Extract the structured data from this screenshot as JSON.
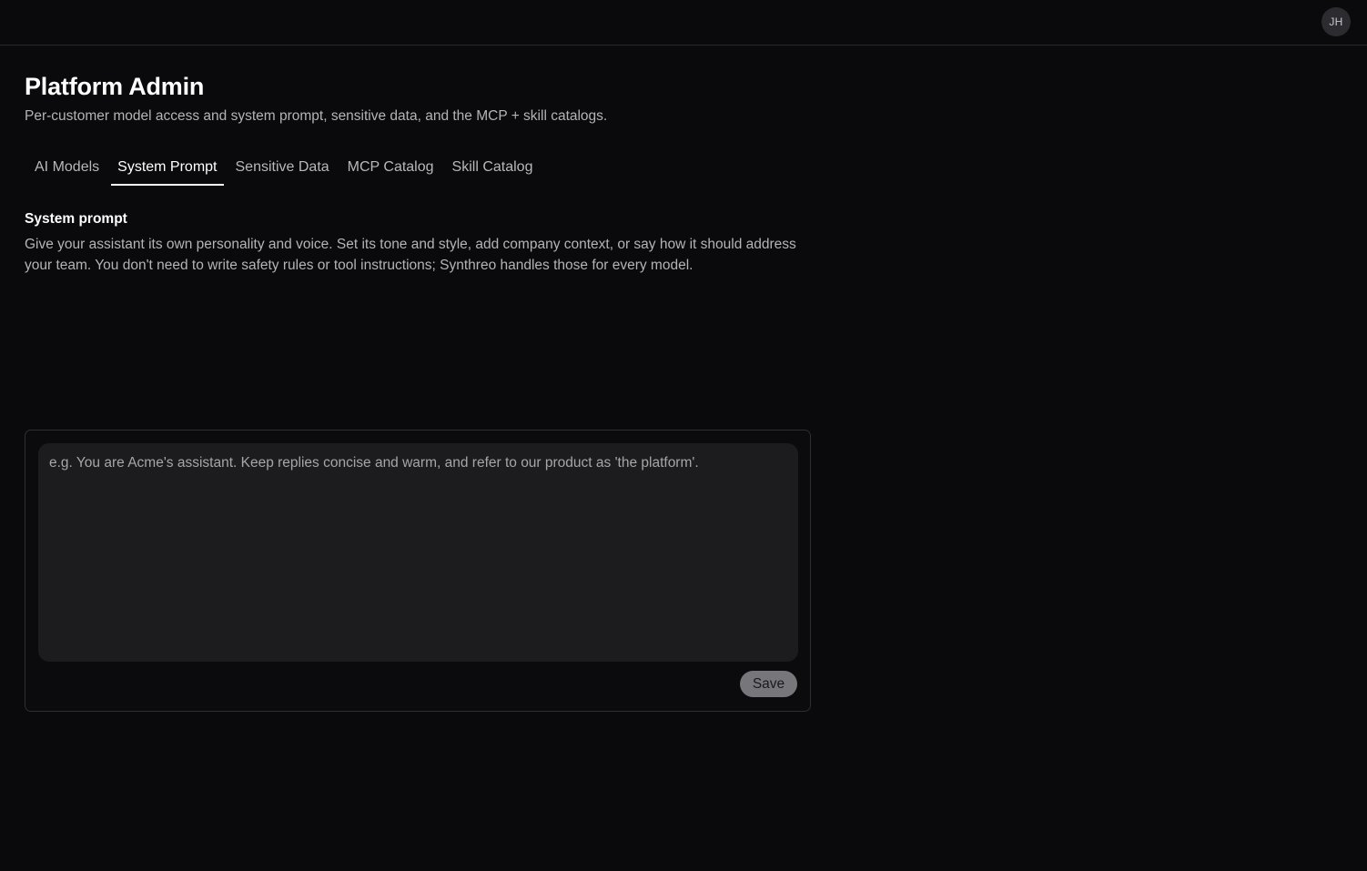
{
  "header": {
    "avatar_initials": "JH"
  },
  "page": {
    "title": "Platform Admin",
    "subtitle": "Per-customer model access and system prompt, sensitive data, and the MCP + skill catalogs."
  },
  "tabs": [
    {
      "label": "AI Models",
      "active": false
    },
    {
      "label": "System Prompt",
      "active": true
    },
    {
      "label": "Sensitive Data",
      "active": false
    },
    {
      "label": "MCP Catalog",
      "active": false
    },
    {
      "label": "Skill Catalog",
      "active": false
    }
  ],
  "system_prompt": {
    "title": "System prompt",
    "description": "Give your assistant its own personality and voice. Set its tone and style, add company context, or say how it should address your team. You don't need to write safety rules or tool instructions; Synthreo handles those for every model.",
    "value": "",
    "placeholder": "e.g. You are Acme's assistant. Keep replies concise and warm, and refer to our product as 'the platform'.",
    "save_label": "Save"
  },
  "colors": {
    "background": "#0a0a0c",
    "text_primary": "#ffffff",
    "text_secondary": "#b4b4b8",
    "input_background": "#1c1c1f",
    "save_button_background": "#77777b",
    "active_tab_underline": "#ffffff"
  }
}
